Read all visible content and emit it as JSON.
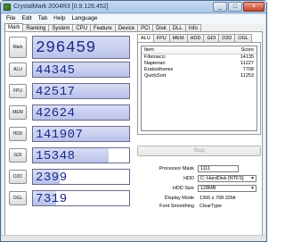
{
  "window": {
    "title": "CrystalMark 2004R3 [0.9.126.452]",
    "controls": [
      "_",
      "□",
      "×"
    ]
  },
  "menu": [
    "File",
    "Edit",
    "Tab",
    "Help",
    "Language"
  ],
  "tabs": [
    "Mark",
    "Ranking",
    "System",
    "CPU",
    "Feature",
    "Device",
    "PCI",
    "Disk",
    "DLL",
    "Info"
  ],
  "scores": [
    {
      "label": "Mark",
      "value": "296459",
      "fill": 1.0
    },
    {
      "label": "ALU",
      "value": "44345",
      "fill": 1.0
    },
    {
      "label": "FPU",
      "value": "42517",
      "fill": 1.0
    },
    {
      "label": "MEM",
      "value": "42624",
      "fill": 1.0
    },
    {
      "label": "HDD",
      "value": "141907",
      "fill": 1.0
    },
    {
      "label": "GDI",
      "value": "15348",
      "fill": 0.79
    },
    {
      "label": "D2D",
      "value": "2399",
      "fill": 0.28
    },
    {
      "label": "OGL",
      "value": "7319",
      "fill": 0.24
    }
  ],
  "subtabs": [
    "ALU",
    "FPU",
    "MEM",
    "HDD",
    "GDI",
    "D2D",
    "OGL"
  ],
  "list": {
    "headers": {
      "item": "Item",
      "score": "Score"
    },
    "rows": [
      {
        "item": "Fibonacci",
        "score": "14135"
      },
      {
        "item": "Napierian",
        "score": "11227"
      },
      {
        "item": "Eratosthenes",
        "score": "7708"
      },
      {
        "item": "QuickSort",
        "score": "11253"
      }
    ]
  },
  "stop_button": "Stop",
  "options": {
    "processor_mask_label": "Processor Mask",
    "processor_mask_value": "1111",
    "hdd_label": "HDD",
    "hdd_value": "C: HardDisk [NTFS]",
    "hdd_size_label": "HDD Size",
    "hdd_size_value": "128MB",
    "display_mode_label": "Display Mode",
    "display_mode_value": "1366 x 768 32bit",
    "font_smoothing_label": "Font Smoothing",
    "font_smoothing_value": "ClearType"
  },
  "colors": {
    "accent": "#1a2a8a",
    "fill": "#b9c1ea",
    "titlebar": "#aac7ea"
  }
}
